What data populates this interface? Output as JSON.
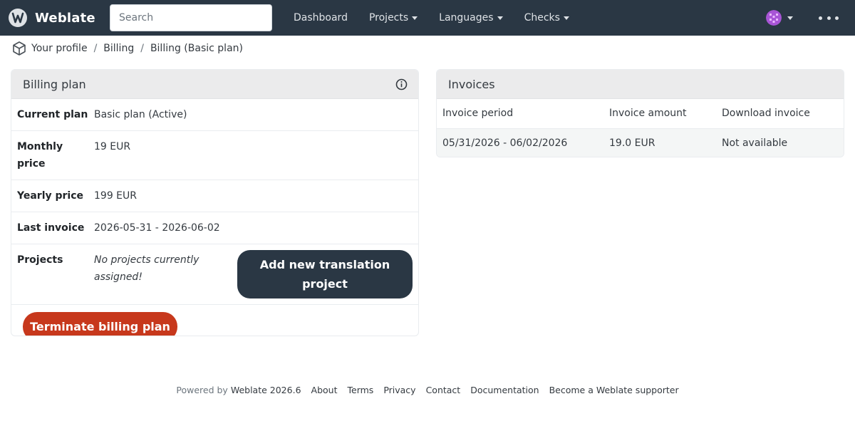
{
  "navbar": {
    "brand": "Weblate",
    "search_placeholder": "Search",
    "items": [
      {
        "label": "Dashboard",
        "dropdown": false
      },
      {
        "label": "Projects",
        "dropdown": true
      },
      {
        "label": "Languages",
        "dropdown": true
      },
      {
        "label": "Checks",
        "dropdown": true
      }
    ],
    "colors": {
      "background": "#2a3744",
      "avatar": "#a855d6"
    }
  },
  "breadcrumb": {
    "items": [
      "Your profile",
      "Billing",
      "Billing (Basic plan)"
    ]
  },
  "billing": {
    "title": "Billing plan",
    "rows": [
      {
        "label": "Current plan",
        "value": "Basic plan (Active)"
      },
      {
        "label": "Monthly price",
        "value": "19 EUR"
      },
      {
        "label": "Yearly price",
        "value": "199 EUR"
      },
      {
        "label": "Last invoice",
        "value": "2026-05-31 - 2026-06-02"
      }
    ],
    "projects_label": "Projects",
    "projects_empty": "No projects currently assigned!",
    "add_project_label": "Add new translation project",
    "terminate_label": "Terminate billing plan",
    "colors": {
      "terminate": "#c7381c",
      "add": "#2a3744"
    }
  },
  "invoices": {
    "title": "Invoices",
    "columns": [
      "Invoice period",
      "Invoice amount",
      "Download invoice"
    ],
    "rows": [
      [
        "05/31/2026 - 06/02/2026",
        "19.0 EUR",
        "Not available"
      ]
    ]
  },
  "footer": {
    "powered_prefix": "Powered by",
    "powered_link": "Weblate 2026.6",
    "links": [
      "About",
      "Terms",
      "Privacy",
      "Contact",
      "Documentation",
      "Become a Weblate supporter"
    ]
  }
}
